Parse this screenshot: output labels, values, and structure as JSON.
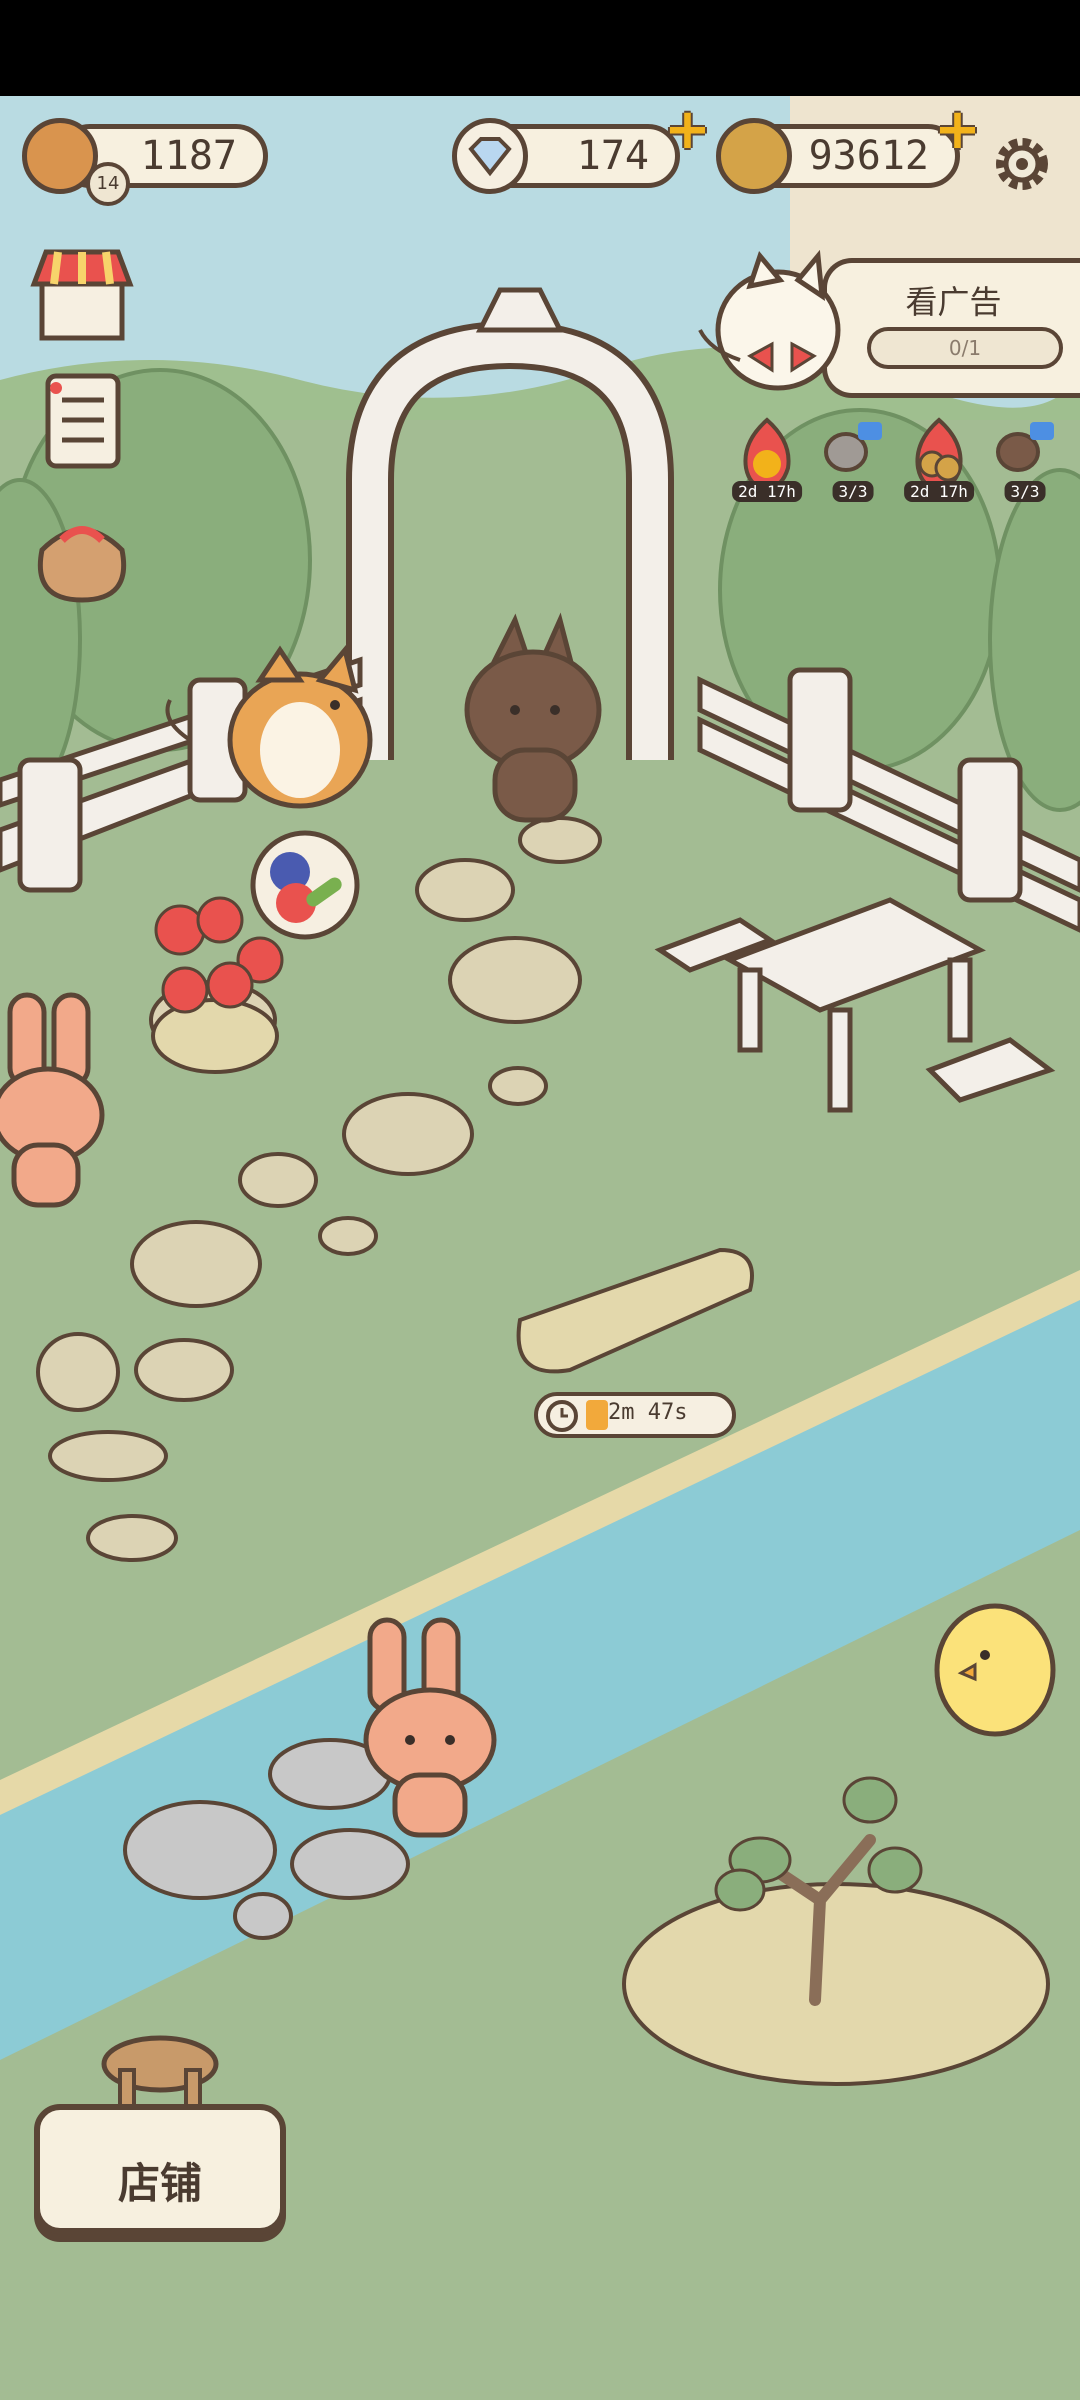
{
  "status_bar": {},
  "hud": {
    "player_level": "14",
    "energy": "1187",
    "diamonds": "174",
    "coins": "93612"
  },
  "ad_panel": {
    "title": "看广告",
    "progress_label": "0/1",
    "progress": 0
  },
  "effects": [
    {
      "icon": "fire-chicken-icon",
      "badge": "2d 17h"
    },
    {
      "icon": "gray-cat-video-icon",
      "badge": "3/3"
    },
    {
      "icon": "fire-coins-icon",
      "badge": "2d 17h"
    },
    {
      "icon": "brown-video-icon",
      "badge": "3/3"
    }
  ],
  "crop_timer": {
    "label": "2m 47s",
    "progress": 0.15
  },
  "shop_button": {
    "label": "店铺"
  },
  "colors": {
    "outline": "#5a4536",
    "panel": "#f7f0df",
    "grass": "#9fb88f",
    "sky": "#b9dbe2",
    "river": "#8ccbd5",
    "plus": "#f2b21a"
  }
}
